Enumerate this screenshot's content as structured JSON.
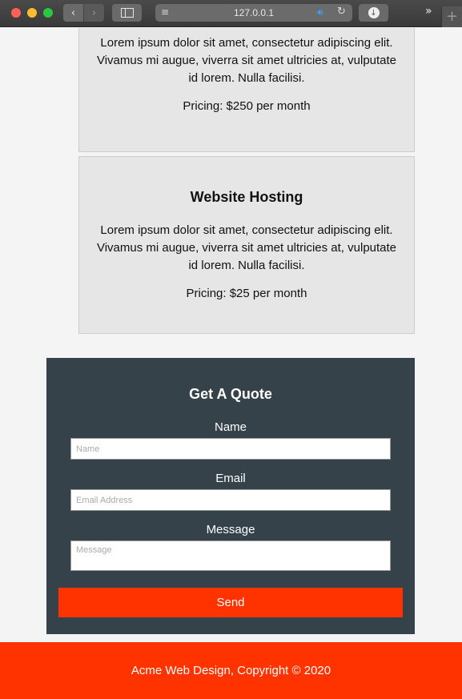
{
  "browser": {
    "url": "127.0.0.1",
    "icons": {
      "back": "chevron-left-icon",
      "forward": "chevron-right-icon",
      "sidebar": "sidebar-icon",
      "reader": "reader-icon",
      "audio": "speaker-icon",
      "reload": "reload-icon",
      "download": "download-icon",
      "overflow": "double-chevron-icon",
      "new_tab": "plus-icon"
    }
  },
  "services": [
    {
      "title": "",
      "description": "Lorem ipsum dolor sit amet, consectetur adipiscing elit. Vivamus mi augue, viverra sit amet ultricies at, vulputate id lorem. Nulla facilisi.",
      "pricing": "Pricing: $250 per month"
    },
    {
      "title": "Website Hosting",
      "description": "Lorem ipsum dolor sit amet, consectetur adipiscing elit. Vivamus mi augue, viverra sit amet ultricies at, vulputate id lorem. Nulla facilisi.",
      "pricing": "Pricing: $25 per month"
    }
  ],
  "quote_form": {
    "title": "Get A Quote",
    "name_label": "Name",
    "name_placeholder": "Name",
    "email_label": "Email",
    "email_placeholder": "Email Address",
    "message_label": "Message",
    "message_placeholder": "Message",
    "send_label": "Send"
  },
  "footer": {
    "text": "Acme Web Design, Copyright © 2020"
  },
  "colors": {
    "accent": "#ff3300",
    "form_bg": "#35424a",
    "card_bg": "#e6e6e6"
  }
}
